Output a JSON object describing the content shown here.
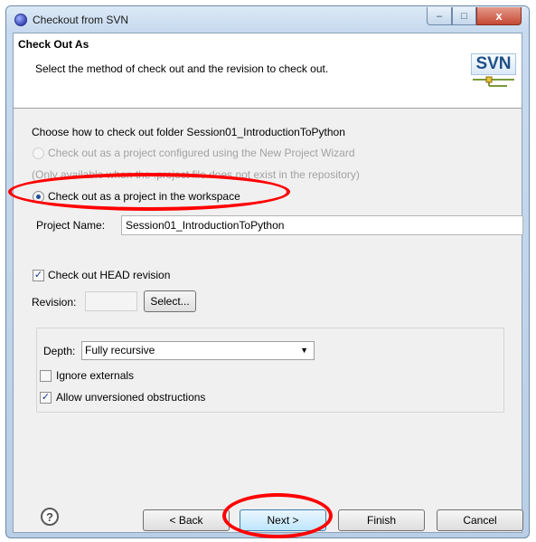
{
  "window": {
    "title": "Checkout from SVN",
    "controls": {
      "minimize": "–",
      "maximize": "□",
      "close": "x"
    }
  },
  "header": {
    "title": "Check Out As",
    "description": "Select the method of check out and the revision to check out.",
    "logo_text": "SVN"
  },
  "checkout": {
    "prompt": "Choose how to check out folder Session01_IntroductionToPython",
    "option_wizard": "Check out as a project configured using the New Project Wizard",
    "option_wizard_note": "(Only available when the .project file does not exist in the repository)",
    "option_workspace": "Check out as a project in the workspace",
    "option_workspace_selected": true
  },
  "project": {
    "label": "Project Name:",
    "value": "Session01_IntroductionToPython"
  },
  "revision": {
    "head_label": "Check out HEAD revision",
    "head_checked": true,
    "label": "Revision:",
    "value": "",
    "select_button": "Select..."
  },
  "depth": {
    "label": "Depth:",
    "selected": "Fully recursive",
    "ignore_externals": "Ignore externals",
    "ignore_externals_checked": false,
    "allow_unversioned": "Allow unversioned obstructions",
    "allow_unversioned_checked": true
  },
  "footer": {
    "help_icon": "?",
    "back": "< Back",
    "next": "Next >",
    "finish": "Finish",
    "cancel": "Cancel"
  },
  "colors": {
    "annotation": "#ff0000",
    "titlebar": "#c4d8ee",
    "client_bg": "#f0f0f0"
  }
}
